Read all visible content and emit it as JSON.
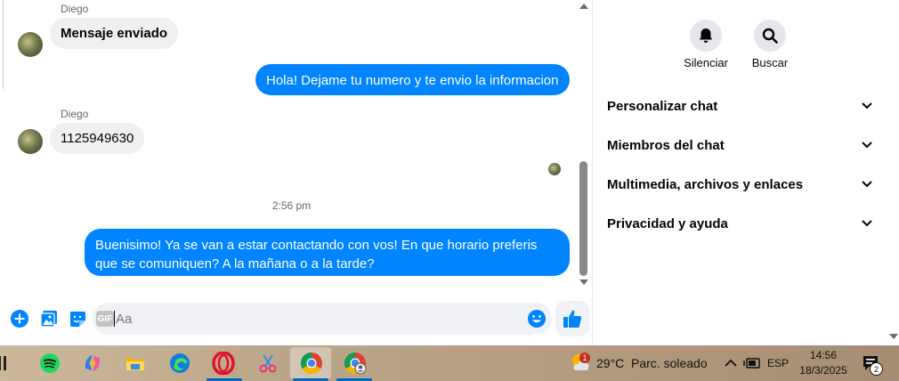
{
  "chat": {
    "messages": [
      {
        "sender": "Diego",
        "text": "Mensaje enviado"
      },
      {
        "text": "Hola! Dejame tu numero y te envio la informacion"
      },
      {
        "sender": "Diego",
        "text": "1125949630"
      },
      {
        "text": "Buenisimo! Ya se van a estar contactando con vos! En que horario preferis que se comuniquen? A la mañana o a la tarde?"
      }
    ],
    "timestamp": "2:56 pm"
  },
  "composer": {
    "gif_label": "GIF",
    "placeholder": "Aa"
  },
  "panel": {
    "mute_label": "Silenciar",
    "search_label": "Buscar",
    "sections": [
      {
        "label": "Personalizar chat"
      },
      {
        "label": "Miembros del chat"
      },
      {
        "label": "Multimedia, archivos y enlaces"
      },
      {
        "label": "Privacidad y ayuda"
      }
    ]
  },
  "taskbar": {
    "weather_temp": "29°C",
    "weather_desc": "Parc. soleado",
    "weather_badge": "1",
    "language": "ESP",
    "time": "14:56",
    "date": "18/3/2025",
    "notification_count": "2"
  },
  "colors": {
    "accent": "#0084ff",
    "incoming_bubble": "#f0f0f0"
  }
}
